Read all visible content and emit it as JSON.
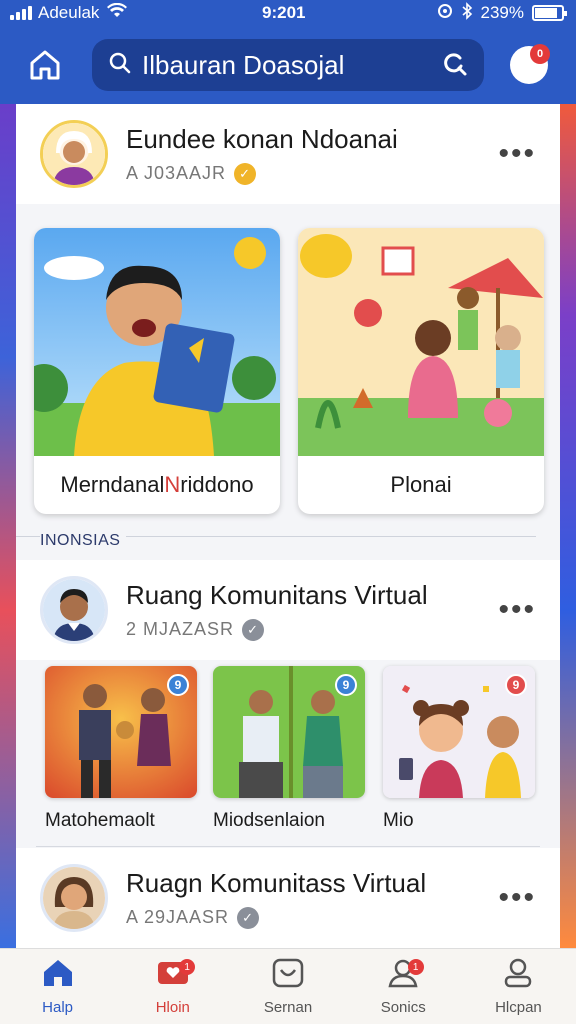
{
  "status_bar": {
    "carrier": "Adeulak",
    "time": "9:201",
    "battery": "239%",
    "battery_level": 0.85
  },
  "header": {
    "home_icon": "home-icon",
    "search_label": "Ilbauran Doasojal",
    "search_icon": "search-icon",
    "notification_count": "0"
  },
  "posts": [
    {
      "name": "Eundee konan Ndoanai",
      "meta": "A J03AAJR",
      "verified_color": "#f0b429"
    },
    {
      "name": "Ruang Komunitans Virtual",
      "meta": "2 MJAZASR",
      "verified_color": "#8a8f99"
    },
    {
      "name": "Ruagn Komunitass Virtual",
      "meta": "A 29JAASR",
      "verified_color": "#8a8f99"
    }
  ],
  "big_cards": [
    {
      "caption_pre": "Merndanal ",
      "caption_accent": "N",
      "caption_post": "riddono"
    },
    {
      "caption": "Plonai"
    }
  ],
  "section_label": "INONSIAS",
  "small_cards": [
    {
      "caption": "Matohemaolt",
      "badge": "9",
      "badge_color": "#3b82d6"
    },
    {
      "caption": "Miodsenlaion",
      "badge": "9",
      "badge_color": "#3b82d6"
    },
    {
      "caption": "Mio",
      "badge": "9",
      "badge_color": "#e24d4d"
    }
  ],
  "bottom_nav": [
    {
      "label": "Halp",
      "icon": "home-icon"
    },
    {
      "label": "Hloin",
      "icon": "heart-message-icon",
      "badge": "1"
    },
    {
      "label": "Sernan",
      "icon": "service-icon"
    },
    {
      "label": "Sonics",
      "icon": "person-icon",
      "badge": "1"
    },
    {
      "label": "Hlcpan",
      "icon": "profile-icon"
    }
  ],
  "colors": {
    "brand": "#2c5ac4",
    "alert": "#e33a3a"
  }
}
